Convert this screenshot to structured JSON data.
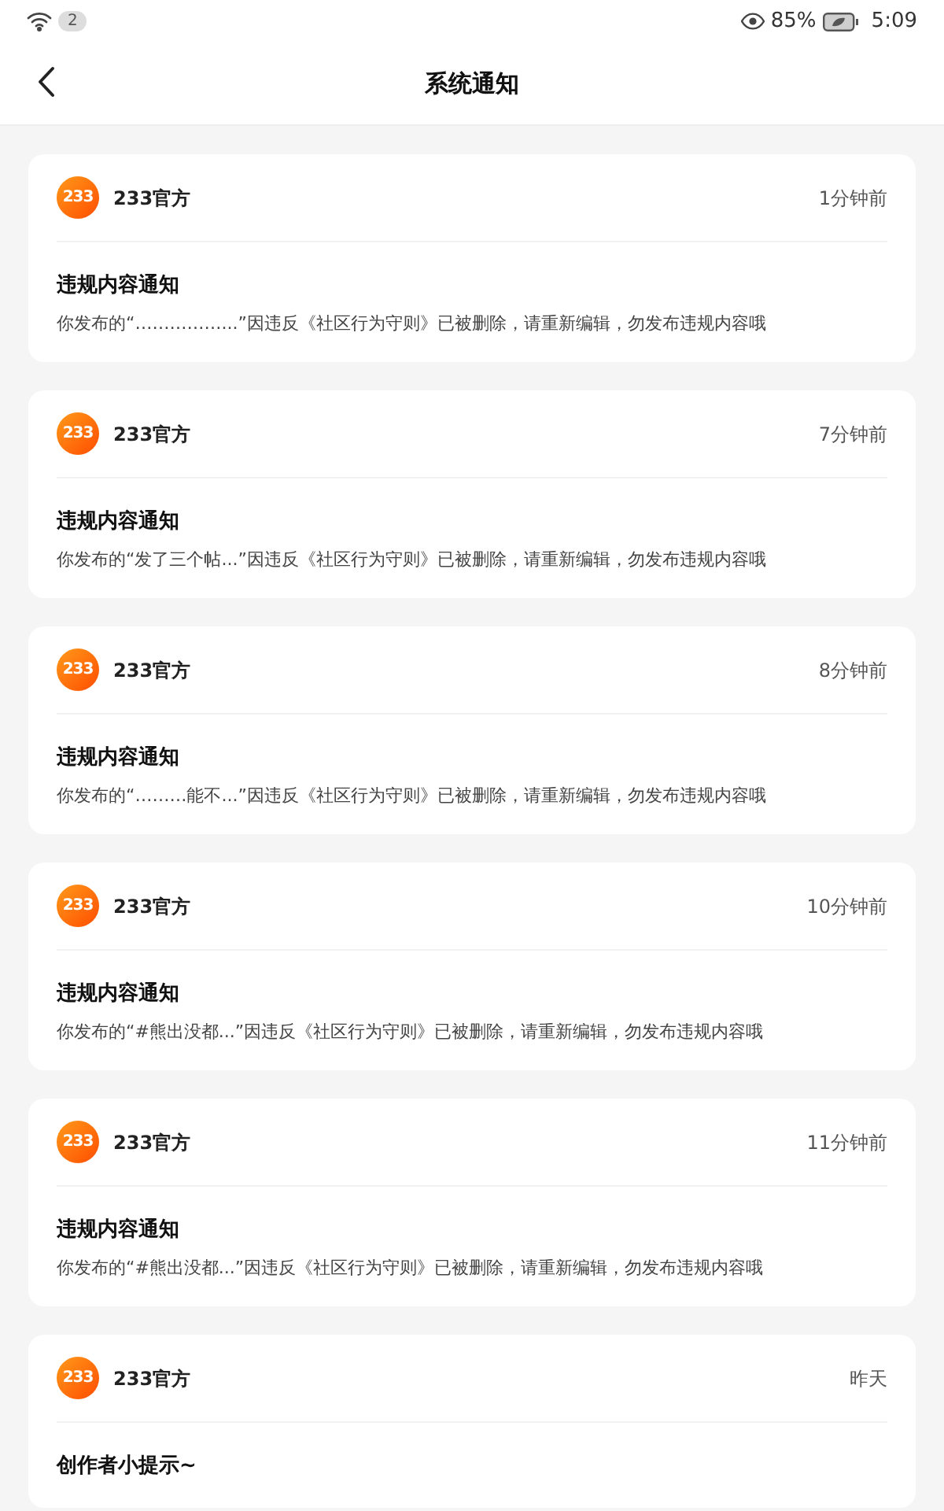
{
  "status_bar": {
    "notification_count": "2",
    "battery_percent": "85%",
    "time": "5:09"
  },
  "header": {
    "title": "系统通知"
  },
  "notifications": [
    {
      "logo": "233",
      "sender": "233官方",
      "time": "1分钟前",
      "title": "违规内容通知",
      "body": "你发布的“……………...”因违反《社区行为守则》已被删除，请重新编辑，勿发布违规内容哦"
    },
    {
      "logo": "233",
      "sender": "233官方",
      "time": "7分钟前",
      "title": "违规内容通知",
      "body": "你发布的“发了三个帖...”因违反《社区行为守则》已被删除，请重新编辑，勿发布违规内容哦"
    },
    {
      "logo": "233",
      "sender": "233官方",
      "time": "8分钟前",
      "title": "违规内容通知",
      "body": "你发布的“………能不...”因违反《社区行为守则》已被删除，请重新编辑，勿发布违规内容哦"
    },
    {
      "logo": "233",
      "sender": "233官方",
      "time": "10分钟前",
      "title": "违规内容通知",
      "body": "你发布的“#熊出没都...”因违反《社区行为守则》已被删除，请重新编辑，勿发布违规内容哦"
    },
    {
      "logo": "233",
      "sender": "233官方",
      "time": "11分钟前",
      "title": "违规内容通知",
      "body": "你发布的“#熊出没都...”因违反《社区行为守则》已被删除，请重新编辑，勿发布违规内容哦"
    },
    {
      "logo": "233",
      "sender": "233官方",
      "time": "昨天",
      "title": "创作者小提示~"
    }
  ]
}
